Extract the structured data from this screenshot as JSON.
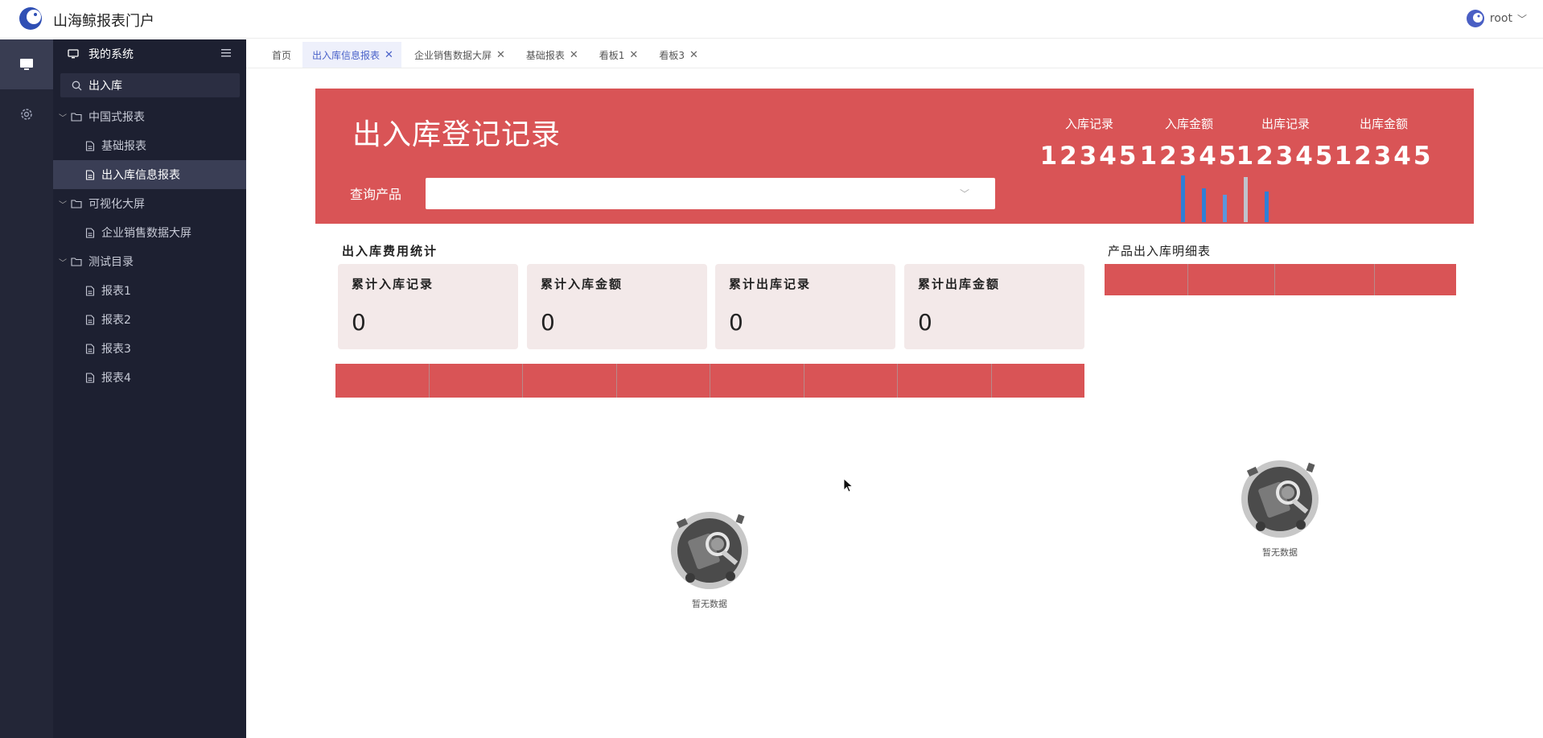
{
  "header": {
    "app_title": "山海鲸报表门户",
    "user_name": "root"
  },
  "sidebar": {
    "section_title": "我的系统",
    "search": {
      "value": "出入库",
      "placeholder": ""
    },
    "tree": [
      {
        "folder": "中国式报表",
        "items": [
          "基础报表",
          "出入库信息报表"
        ]
      },
      {
        "folder": "可视化大屏",
        "items": [
          "企业销售数据大屏"
        ]
      },
      {
        "folder": "测试目录",
        "items": [
          "报表1",
          "报表2",
          "报表3",
          "报表4"
        ]
      }
    ],
    "active_item": "出入库信息报表"
  },
  "tabs": [
    {
      "label": "首页",
      "closable": false
    },
    {
      "label": "出入库信息报表",
      "closable": true,
      "active": true
    },
    {
      "label": "企业销售数据大屏",
      "closable": true
    },
    {
      "label": "基础报表",
      "closable": true
    },
    {
      "label": "看板1",
      "closable": true
    },
    {
      "label": "看板3",
      "closable": true
    }
  ],
  "banner": {
    "title": "出入库登记记录",
    "query_label": "查询产品",
    "select_value": "",
    "stats": [
      {
        "label": "入库记录",
        "value": "12345"
      },
      {
        "label": "入库金额",
        "value": "12345"
      },
      {
        "label": "出库记录",
        "value": "12345"
      },
      {
        "label": "出库金额",
        "value": "12345"
      }
    ]
  },
  "cost_section": {
    "title": "出入库费用统计",
    "cards": [
      {
        "label": "累计入库记录",
        "value": "0"
      },
      {
        "label": "累计入库金额",
        "value": "0"
      },
      {
        "label": "累计出库记录",
        "value": "0"
      },
      {
        "label": "累计出库金额",
        "value": "0"
      }
    ]
  },
  "detail_section": {
    "title": "产品出入库明细表"
  },
  "empty_text": "暂无数据",
  "colors": {
    "banner_red": "#d95456",
    "card_bg": "#f3e9e9",
    "sidebar_bg": "#1d2031",
    "accent": "#4a62c9"
  }
}
